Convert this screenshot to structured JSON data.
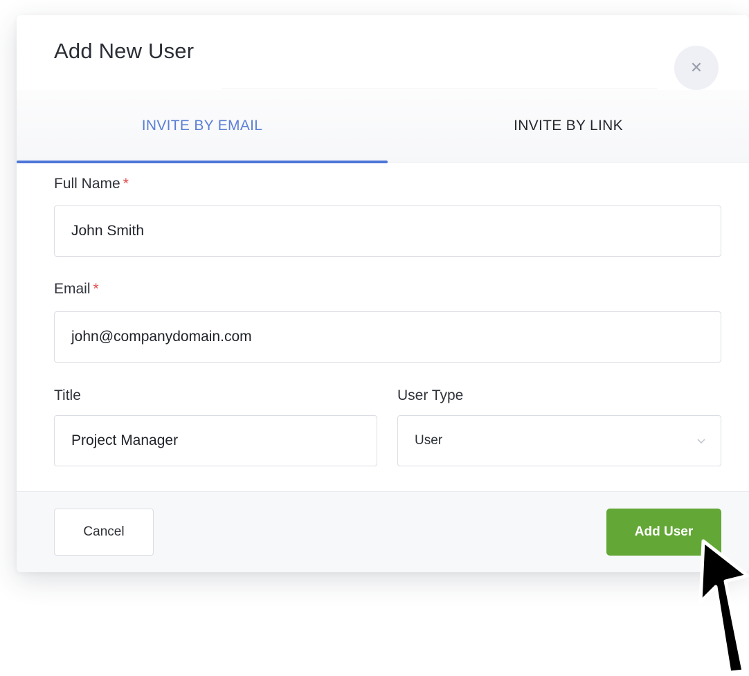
{
  "modal": {
    "title": "Add New User",
    "close_icon": "close-icon"
  },
  "tabs": [
    {
      "label": "INVITE BY EMAIL",
      "active": true
    },
    {
      "label": "INVITE BY LINK",
      "active": false
    }
  ],
  "form": {
    "full_name": {
      "label": "Full Name",
      "required_mark": "*",
      "value": "John Smith"
    },
    "email": {
      "label": "Email",
      "required_mark": "*",
      "value": "john@companydomain.com"
    },
    "title": {
      "label": "Title",
      "value": "Project Manager"
    },
    "user_type": {
      "label": "User Type",
      "selected": "User",
      "icon": "chevron-down-icon"
    }
  },
  "footer": {
    "cancel_label": "Cancel",
    "add_label": "Add User"
  },
  "colors": {
    "accent": "#4d76d8",
    "primary_button": "#63a737",
    "required": "#e34b4b"
  }
}
